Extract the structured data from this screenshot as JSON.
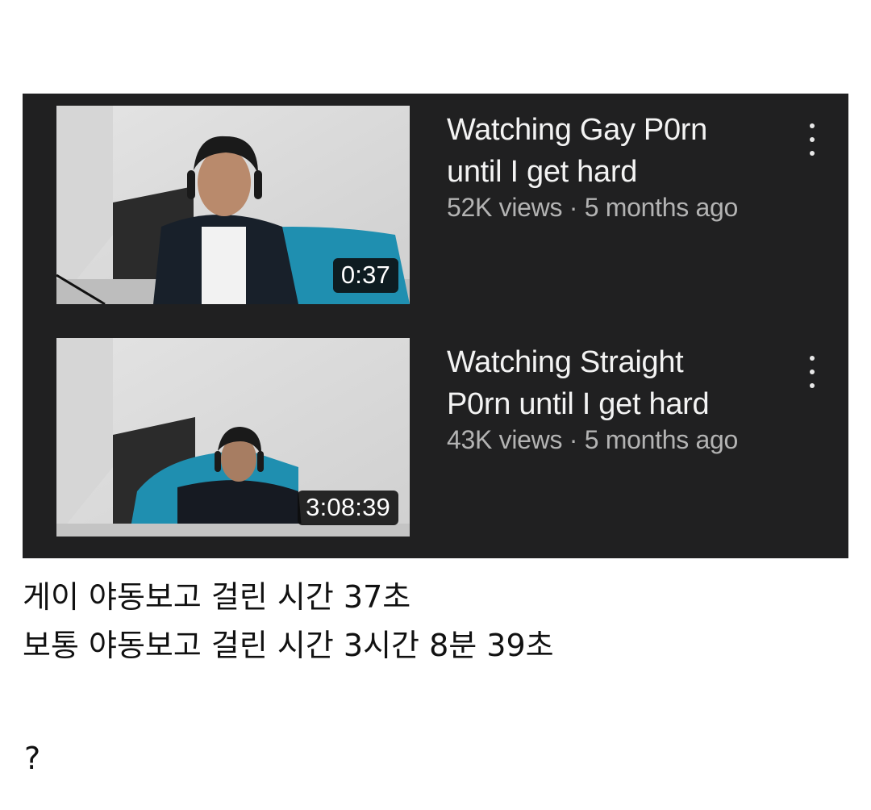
{
  "videos": [
    {
      "title_line1": "Watching Gay P0rn",
      "title_line2": "until I get hard",
      "views": "52K views",
      "separator": "·",
      "age": "5 months ago",
      "duration": "0:37",
      "menu_icon": "more-vert-icon"
    },
    {
      "title_line1": "Watching Straight",
      "title_line2": "P0rn until I get hard",
      "views": "43K views",
      "separator": "·",
      "age": "5 months ago",
      "duration": "3:08:39",
      "menu_icon": "more-vert-icon"
    }
  ],
  "caption": {
    "line1": "게이 야동보고 걸린 시간 37초",
    "line2": "보통 야동보고 걸린 시간 3시간 8분 39초",
    "line3": "?"
  },
  "colors": {
    "panel_bg": "#202021",
    "title_text": "#f3f3f3",
    "meta_text": "#b3b3b3",
    "badge_bg": "#0c0c0c"
  }
}
